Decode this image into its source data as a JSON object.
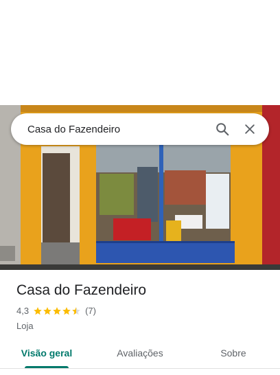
{
  "search": {
    "value": "Casa do Fazendeiro"
  },
  "place": {
    "name": "Casa do Fazendeiro",
    "rating_text": "4,3",
    "rating_value": 4.3,
    "review_count": "(7)",
    "category": "Loja"
  },
  "tabs": [
    {
      "label": "Visão geral",
      "active": true
    },
    {
      "label": "Avaliações",
      "active": false
    },
    {
      "label": "Sobre",
      "active": false
    }
  ],
  "colors": {
    "accent": "#00796b",
    "star": "#fbbc04"
  },
  "icons": {
    "search": "search-icon",
    "close": "close-icon",
    "star": "star-icon"
  }
}
